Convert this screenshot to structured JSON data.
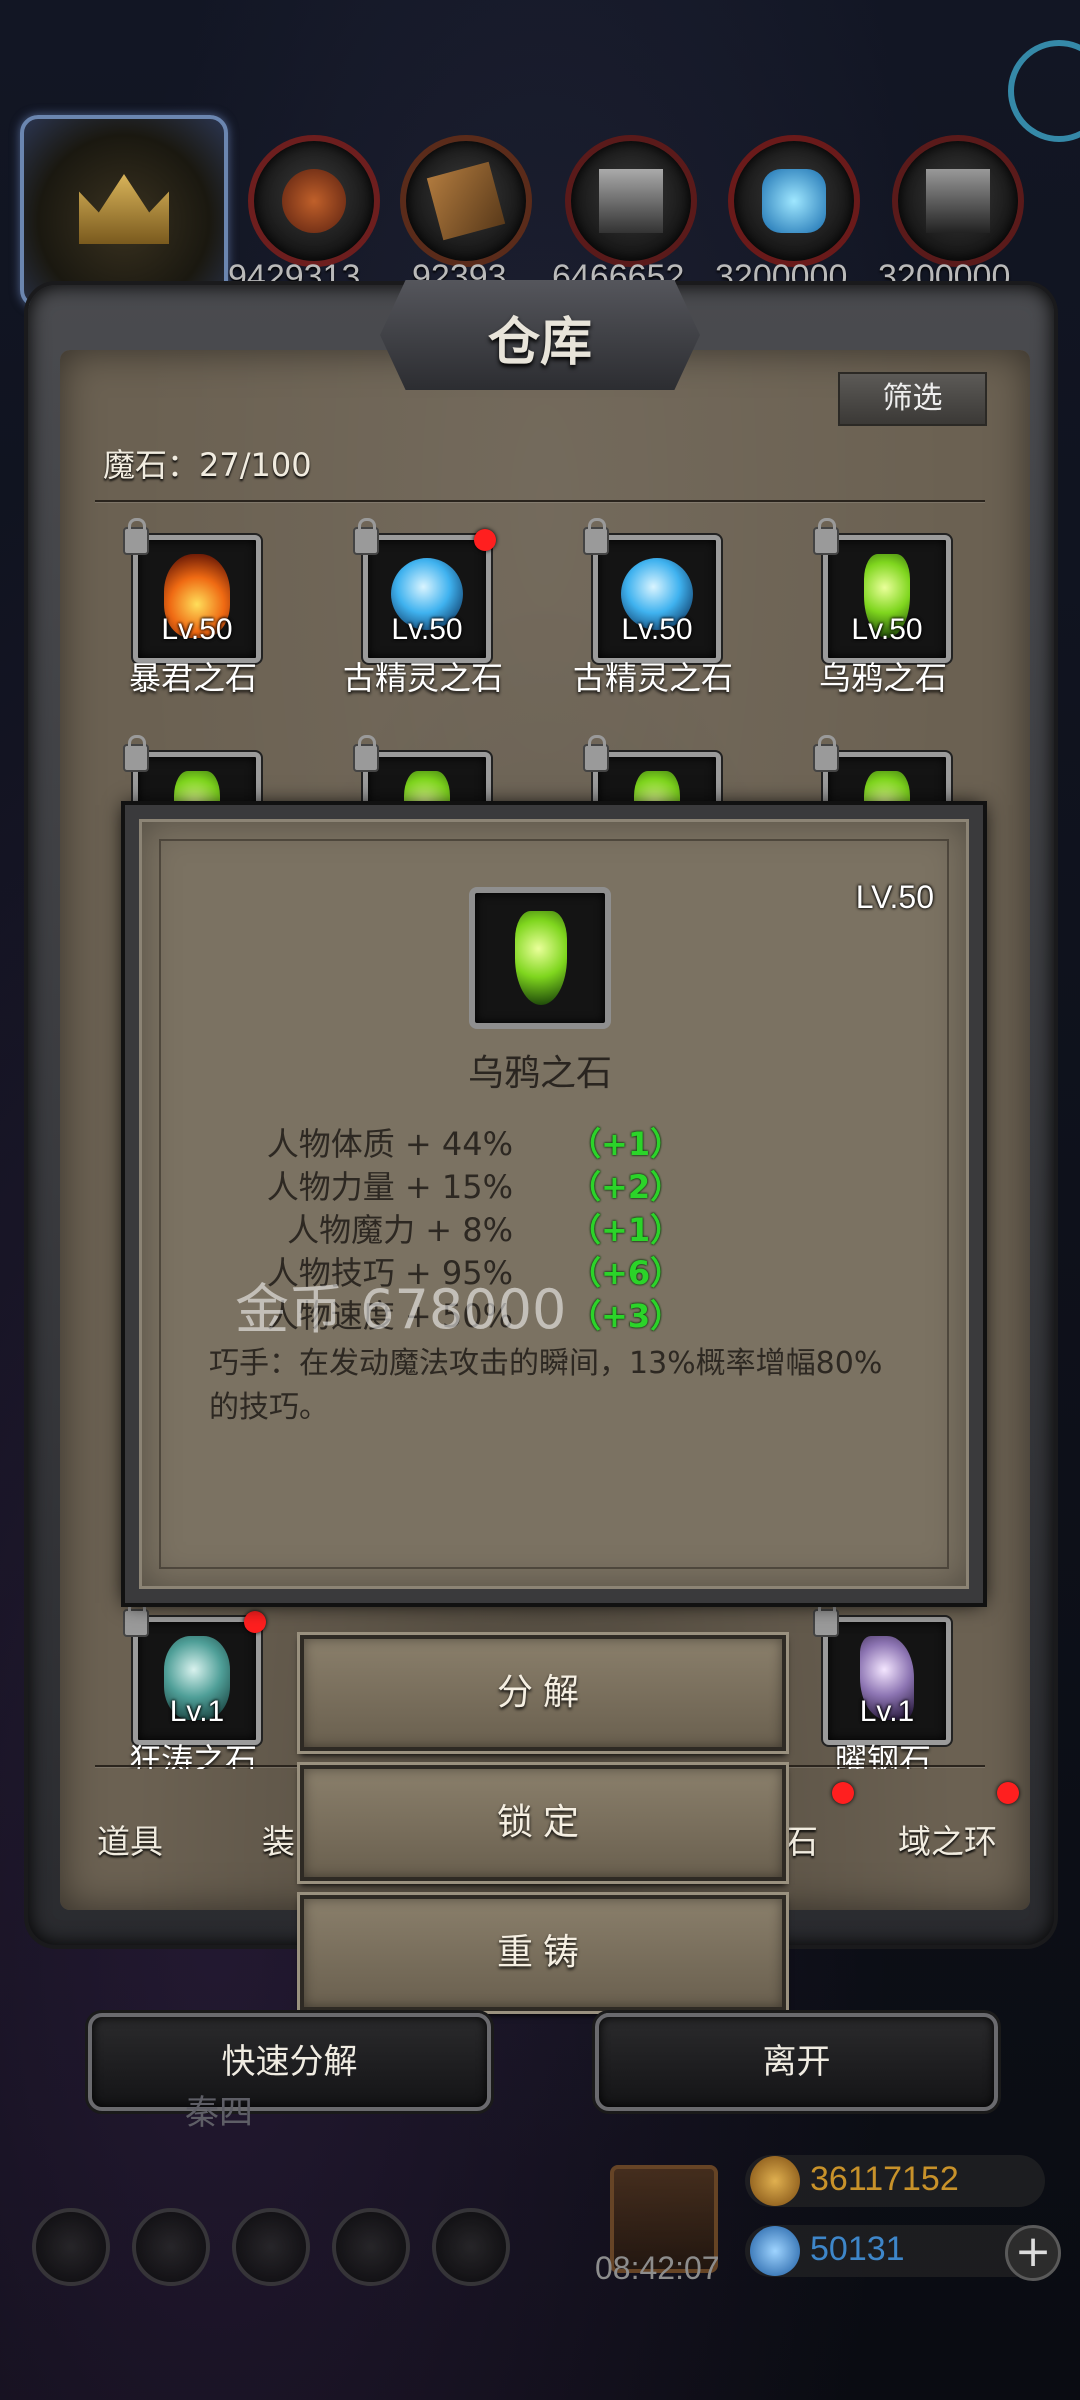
{
  "resources": [
    {
      "icon": "ore-icon",
      "value": "9429313"
    },
    {
      "icon": "wood-icon",
      "value": "92393"
    },
    {
      "icon": "iron-icon",
      "value": "6466652"
    },
    {
      "icon": "crystal-icon",
      "value": "3200000"
    },
    {
      "icon": "steel-icon",
      "value": "3200000"
    }
  ],
  "warehouse": {
    "title": "仓库",
    "filter_label": "筛选",
    "count_label": "魔石：27/100"
  },
  "slots_row1": [
    {
      "level": "Lv.50",
      "name": "暴君之石",
      "gem": "fire",
      "locked": true,
      "new": false
    },
    {
      "level": "Lv.50",
      "name": "古精灵之石",
      "gem": "blue",
      "locked": true,
      "new": true
    },
    {
      "level": "Lv.50",
      "name": "古精灵之石",
      "gem": "blue",
      "locked": true,
      "new": false
    },
    {
      "level": "Lv.50",
      "name": "乌鸦之石",
      "gem": "green",
      "locked": true,
      "new": false
    }
  ],
  "slots_bottom": [
    {
      "level": "Lv.1",
      "name": "狂涛之石",
      "gem": "teal",
      "locked": true,
      "new": true
    },
    {
      "level": "Lv.1",
      "name": "曜钢石",
      "gem": "violet",
      "locked": true,
      "new": false
    }
  ],
  "tabs": [
    "道具",
    "装",
    "魔石",
    "域之环"
  ],
  "tooltip": {
    "level": "LV.50",
    "name": "乌鸦之石",
    "attributes": [
      {
        "label": "人物体质 + 44%",
        "bonus": "（+1）"
      },
      {
        "label": "人物力量 + 15%",
        "bonus": "（+2）"
      },
      {
        "label": "人物魔力 + 8%",
        "bonus": "（+1）"
      },
      {
        "label": "人物技巧 + 95%",
        "bonus": "（+6）"
      },
      {
        "label": "人物速度 + 50%",
        "bonus": "（+3）"
      }
    ],
    "description": "巧手：在发动魔法攻击的瞬间，13%概率增幅80%的技巧。"
  },
  "gold_overlay": "金币  678000",
  "actions": [
    "分解",
    "锁定",
    "重铸"
  ],
  "bottom_buttons": {
    "quick_decompose": "快速分解",
    "leave": "离开"
  },
  "hud": {
    "time": "08:42:07",
    "gold": "36117152",
    "gems": "50131",
    "faded_text": "秦四"
  },
  "colors": {
    "bonus_green": "#2bd429",
    "new_dot": "#ff1f1f",
    "gold_text": "#c8922a",
    "gem_text": "#3e86c9"
  }
}
